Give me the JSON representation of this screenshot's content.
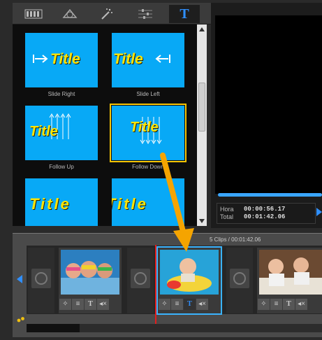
{
  "toolbar": {
    "tabs": [
      {
        "icon": "filmstrip-icon"
      },
      {
        "icon": "transition-icon"
      },
      {
        "icon": "magic-wand-icon"
      },
      {
        "icon": "sliders-icon"
      },
      {
        "icon": "title-T-icon",
        "label": "T"
      }
    ]
  },
  "gallery": {
    "items": [
      {
        "title": "Title",
        "label": "Slide Right"
      },
      {
        "title": "Title",
        "label": "Slide Left"
      },
      {
        "title": "Title",
        "label": "Follow Up"
      },
      {
        "title": "Title",
        "label": "Follow Down"
      },
      {
        "title": "Title",
        "label": ""
      },
      {
        "title": "Title",
        "label": ""
      }
    ]
  },
  "timebox": {
    "hora_label": "Hora",
    "hora_value": "00:00:56.17",
    "total_label": "Total",
    "total_value": "00:01:42.06"
  },
  "timeline": {
    "clips_info": "5 Clips / 00:01:42.06",
    "clip_tool_text_label": "T"
  },
  "colors": {
    "accent": "#2f8fff",
    "tile": "#08a9f6",
    "title_text": "#ffe400",
    "selection": "#f5c400",
    "arrow": "#f5a400",
    "playhead": "#e31d1d"
  }
}
